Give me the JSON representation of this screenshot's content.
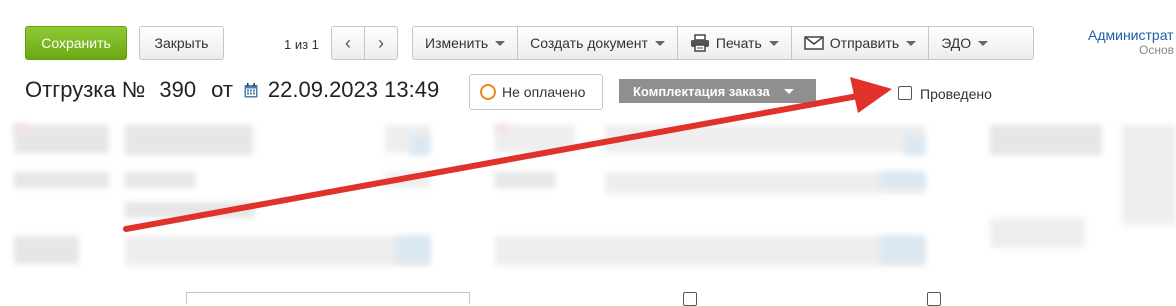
{
  "toolbar": {
    "save_label": "Сохранить",
    "close_label": "Закрыть",
    "pager_text": "1 из 1",
    "menu": [
      {
        "label": "Изменить"
      },
      {
        "label": "Создать документ"
      },
      {
        "label": "Печать",
        "icon": "printer-icon"
      },
      {
        "label": "Отправить",
        "icon": "envelope-icon"
      },
      {
        "label": "ЭДО"
      }
    ]
  },
  "user": {
    "name": "Администрат",
    "subtitle": "Основ"
  },
  "document": {
    "title_prefix": "Отгрузка №",
    "number": "390",
    "date_prefix": "от",
    "datetime": "22.09.2023 13:49",
    "payment_status": "Не оплачено",
    "order_status": "Комплектация заказа",
    "posted_label": "Проведено",
    "posted_checked": false
  },
  "colors": {
    "save_button": "#7cb82f",
    "status_dropdown": "#8f8f8f",
    "payment_ring": "#e88a1a",
    "annotation_arrow": "#e0312a",
    "user_link": "#1a5ea8"
  }
}
